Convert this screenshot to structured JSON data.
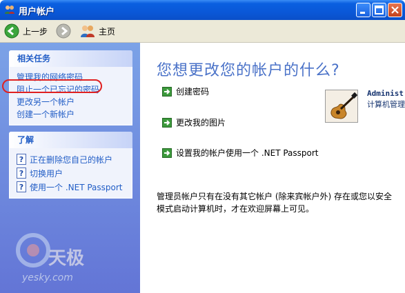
{
  "window": {
    "title": "用户帐户"
  },
  "toolbar": {
    "back_label": "上一步",
    "home_label": "主页"
  },
  "tasks": {
    "header": "相关任务",
    "items": [
      {
        "label": "管理我的网络密码"
      },
      {
        "label": "阻止一个已忘记的密码"
      },
      {
        "label": "更改另一个帐户"
      },
      {
        "label": "创建一个新帐户"
      }
    ]
  },
  "learn": {
    "header": "了解",
    "items": [
      {
        "label": "正在删除您自己的帐户"
      },
      {
        "label": "切换用户"
      },
      {
        "label": "使用一个 .NET Passport"
      }
    ]
  },
  "main": {
    "title": "您想更改您的帐户的什么?",
    "actions": [
      {
        "label": "创建密码"
      },
      {
        "label": "更改我的图片"
      },
      {
        "label": "设置我的帐户使用一个 .NET Passport"
      }
    ],
    "account": {
      "name": "Administ",
      "type": "计算机管理"
    },
    "note": "管理员帐户只有在没有其它帐户 (除来宾帐户外) 存在或您以安全模式启动计算机时，才在欢迎屏幕上可见。"
  },
  "watermark": {
    "brand": "天极",
    "site": "yesky.com"
  },
  "colors": {
    "title_bar": "#0a58d8",
    "link": "#215dc6",
    "left_pane": "#7ba2e7",
    "title": "#4a72c8",
    "highlight": "#e02020"
  }
}
